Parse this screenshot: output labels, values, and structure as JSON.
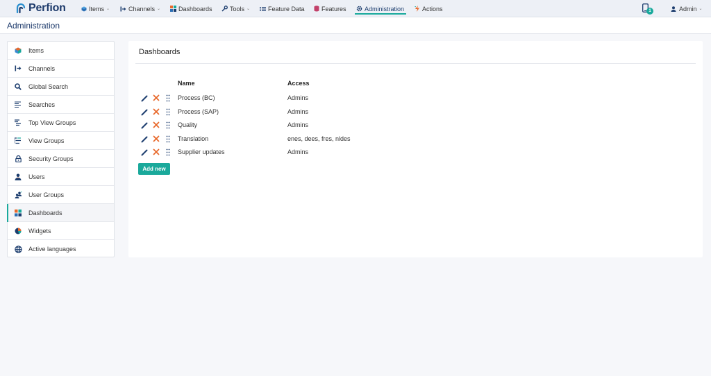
{
  "app": {
    "brand": "Perfion"
  },
  "nav": {
    "items": [
      {
        "label": "Items",
        "icon": "cube-icon",
        "dropdown": true
      },
      {
        "label": "Channels",
        "icon": "channel-icon",
        "dropdown": true
      },
      {
        "label": "Dashboards",
        "icon": "dashboard-grid-icon",
        "dropdown": false
      },
      {
        "label": "Tools",
        "icon": "wrench-icon",
        "dropdown": true
      },
      {
        "label": "Feature Data",
        "icon": "list-icon",
        "dropdown": false
      },
      {
        "label": "Features",
        "icon": "database-icon",
        "dropdown": false
      },
      {
        "label": "Administration",
        "icon": "gear-icon",
        "dropdown": false,
        "active": true
      },
      {
        "label": "Actions",
        "icon": "lightning-icon",
        "dropdown": false
      }
    ],
    "notification_count": "1",
    "user": "Admin"
  },
  "page": {
    "title": "Administration"
  },
  "sidebar": {
    "items": [
      {
        "label": "Items",
        "icon": "cube-icon"
      },
      {
        "label": "Channels",
        "icon": "channel-icon"
      },
      {
        "label": "Global Search",
        "icon": "search-icon"
      },
      {
        "label": "Searches",
        "icon": "searches-icon"
      },
      {
        "label": "Top View Groups",
        "icon": "top-view-groups-icon"
      },
      {
        "label": "View Groups",
        "icon": "view-groups-icon"
      },
      {
        "label": "Security Groups",
        "icon": "lock-icon"
      },
      {
        "label": "Users",
        "icon": "user-icon"
      },
      {
        "label": "User Groups",
        "icon": "user-groups-icon"
      },
      {
        "label": "Dashboards",
        "icon": "dashboard-grid-icon",
        "active": true
      },
      {
        "label": "Widgets",
        "icon": "pie-chart-icon"
      },
      {
        "label": "Active languages",
        "icon": "globe-icon"
      }
    ]
  },
  "main": {
    "title": "Dashboards",
    "columns": {
      "name": "Name",
      "access": "Access"
    },
    "rows": [
      {
        "name": "Process (BC)",
        "access": "Admins"
      },
      {
        "name": "Process (SAP)",
        "access": "Admins"
      },
      {
        "name": "Quality",
        "access": "Admins"
      },
      {
        "name": "Translation",
        "access": "enes, dees, fres, nldes"
      },
      {
        "name": "Supplier updates",
        "access": "Admins"
      }
    ],
    "add_button": "Add new"
  },
  "colors": {
    "accent": "#18a99c",
    "brand": "#1d3a6b",
    "delete": "#e8692c",
    "edit": "#1c3d6e"
  }
}
